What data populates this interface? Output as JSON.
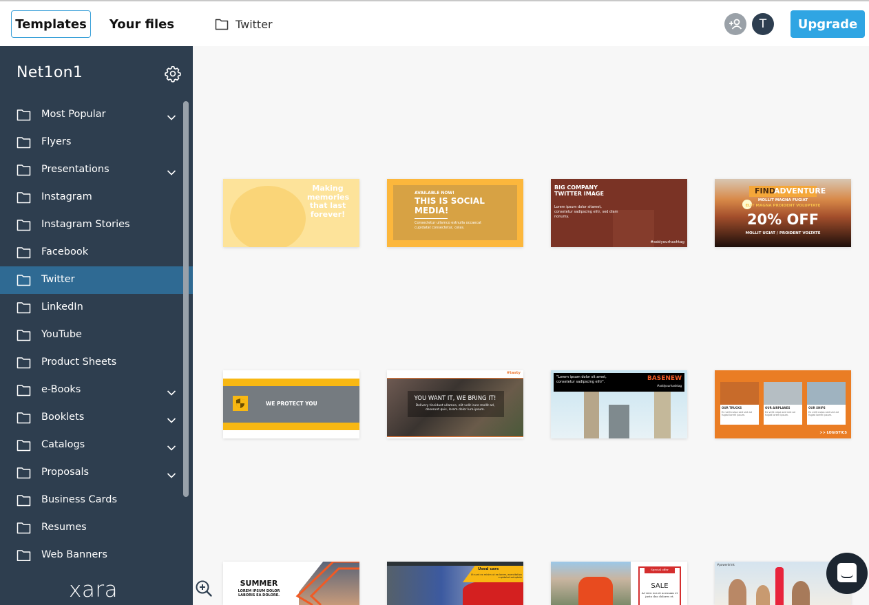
{
  "header": {
    "tabs": [
      {
        "label": "Templates",
        "active": true
      },
      {
        "label": "Your files",
        "active": false
      }
    ],
    "breadcrumb": {
      "icon": "folder-icon",
      "label": "Twitter"
    },
    "invite_icon": "add-user-icon",
    "avatar_initial": "T",
    "upgrade_label": "Upgrade",
    "accent_color": "#2fa5e3"
  },
  "sidebar": {
    "org_name": "Net1on1",
    "settings_icon": "gear-icon",
    "items": [
      {
        "label": "Most Popular",
        "expandable": true
      },
      {
        "label": "Flyers",
        "expandable": false
      },
      {
        "label": "Presentations",
        "expandable": true
      },
      {
        "label": "Instagram",
        "expandable": false
      },
      {
        "label": "Instagram Stories",
        "expandable": false
      },
      {
        "label": "Facebook",
        "expandable": false
      },
      {
        "label": "Twitter",
        "expandable": false,
        "active": true
      },
      {
        "label": "LinkedIn",
        "expandable": false
      },
      {
        "label": "YouTube",
        "expandable": false
      },
      {
        "label": "Product Sheets",
        "expandable": false
      },
      {
        "label": "e-Books",
        "expandable": true
      },
      {
        "label": "Booklets",
        "expandable": true
      },
      {
        "label": "Catalogs",
        "expandable": true
      },
      {
        "label": "Proposals",
        "expandable": true
      },
      {
        "label": "Business Cards",
        "expandable": false
      },
      {
        "label": "Resumes",
        "expandable": false
      },
      {
        "label": "Web Banners",
        "expandable": false
      }
    ],
    "logo": "xara",
    "active_color": "#2f6a93",
    "bg_color": "#2e3e4f"
  },
  "templates": [
    {
      "name": "making-memories",
      "lines": [
        "Making",
        "memories",
        "that last",
        "forever!"
      ]
    },
    {
      "name": "social-media",
      "kicker": "AVAILABLE NOW!",
      "title": "THIS IS SOCIAL MEDIA!",
      "body": "Consectetur ullamco estnulla occaecat cupidatat consectetur, celas."
    },
    {
      "name": "big-company",
      "title": "BIG COMPANY TWITTER IMAGE",
      "body": "Lorem ipsum dolor sitamet, consetetur sadipscing elitr, sed diam nonumy.",
      "hashtag": "#addyourhashtag"
    },
    {
      "name": "find-adventure",
      "title_a": "FIND",
      "title_b": "ADVENTURE",
      "line1": "MOLLIT MAGNA FUGIAT",
      "line2": "ELIT MAGNA PROIDENT VOLUPTATE",
      "offer": "20% OFF",
      "footer": "MOLLIT UGIAT / PROIDENT VOLTATE"
    },
    {
      "name": "we-protect-you",
      "title": "WE PROTECT YOU"
    },
    {
      "name": "we-bring-it",
      "brand": "#tasty",
      "title": "YOU WANT IT, WE BRING IT!",
      "body": "Delivery tincidunt ullamco, elit velit irure mollit ad, deserunt quis, lorem dolor lure ipsum."
    },
    {
      "name": "basenew",
      "quote": "\"Lorem ipsum dolor sit amet, consetetur sadipscing elitr\".",
      "brand": "BASENEW",
      "hashtag": "#addyourhashtag"
    },
    {
      "name": "logistics",
      "cols": [
        {
          "title": "OUR TRUCKS",
          "body": "Ex velit culpa sed sint ad fugiat lorem ipsum."
        },
        {
          "title": "OUR AIRPLANES",
          "body": "Ex velit culpa sed sint ad fugiat lorem ipsum."
        },
        {
          "title": "OUR SHIPS",
          "body": "Ex velit culpa sed sint ad fugiat lorem ipsum."
        }
      ],
      "footer": ">> LOGISTICS"
    },
    {
      "name": "summer",
      "title": "SUMMER",
      "body": "LOREM IPSUM DOLOR LABORIS EA DOLORE."
    },
    {
      "name": "used-cars",
      "title": "Used cars",
      "body": "Ut sunt ex minim ut ea lorem, exercitation cupidatat voluptate"
    },
    {
      "name": "sale",
      "tag": "Special offer",
      "title": "SALE",
      "body": "At vero eos et accusam et justo duo dolores et."
    },
    {
      "name": "powerdrink",
      "hashtag": "#powerdrink"
    }
  ],
  "zoom_icon": "zoom-in-icon",
  "chat_icon": "chat-icon"
}
